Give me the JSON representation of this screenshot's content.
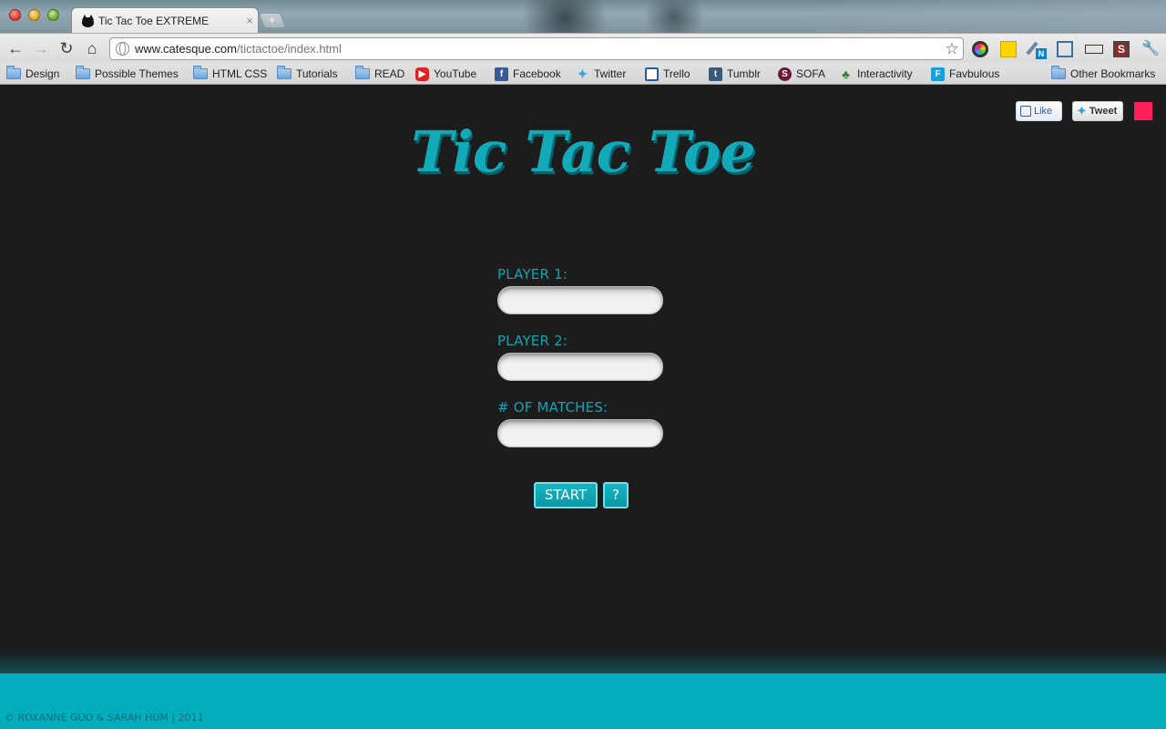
{
  "browser": {
    "tab_title": "Tic Tac Toe EXTREME",
    "tab_close": "×",
    "new_tab": "+",
    "url_host": "www.catesque.com",
    "url_path": "/tictactoe/index.html",
    "nav": {
      "back": "←",
      "forward": "→",
      "reload": "↻",
      "home": "⌂"
    },
    "star": "☆",
    "extensions": [
      "color-wheel-icon",
      "sticky-note-icon",
      "pen-n-icon",
      "screenshot-icon",
      "ruler-icon",
      "s-logo-icon",
      "wrench-icon"
    ]
  },
  "bookmarks": [
    {
      "label": "Design",
      "icon": "folder-icon"
    },
    {
      "label": "Possible Themes",
      "icon": "folder-icon"
    },
    {
      "label": "HTML CSS",
      "icon": "folder-icon"
    },
    {
      "label": "Tutorials",
      "icon": "folder-icon"
    },
    {
      "label": "READ",
      "icon": "folder-icon"
    },
    {
      "label": "YouTube",
      "icon": "youtube-icon"
    },
    {
      "label": "Facebook",
      "icon": "facebook-icon"
    },
    {
      "label": "Twitter",
      "icon": "twitter-icon"
    },
    {
      "label": "Trello",
      "icon": "trello-icon"
    },
    {
      "label": "Tumblr",
      "icon": "tumblr-icon"
    },
    {
      "label": "SOFA",
      "icon": "sofa-icon"
    },
    {
      "label": "Interactivity",
      "icon": "plant-icon"
    },
    {
      "label": "Favbulous",
      "icon": "favbulous-icon"
    }
  ],
  "other_bookmarks": "Other Bookmarks",
  "social": {
    "like": "Like",
    "tweet": "Tweet"
  },
  "game": {
    "title": "Tic Tac Toe",
    "player1_label": "PLAYER 1:",
    "player2_label": "PLAYER 2:",
    "matches_label": "# OF MATCHES:",
    "player1_value": "",
    "player2_value": "",
    "matches_value": "",
    "start_label": "START",
    "help_label": "?"
  },
  "footer": {
    "copyright": "© ROXANNE GUO & SARAH HUM | 2011"
  },
  "colors": {
    "accent": "#03adbe",
    "title": "#12a9b8",
    "background": "#1c1c1c",
    "pink": "#ff1f5a"
  }
}
